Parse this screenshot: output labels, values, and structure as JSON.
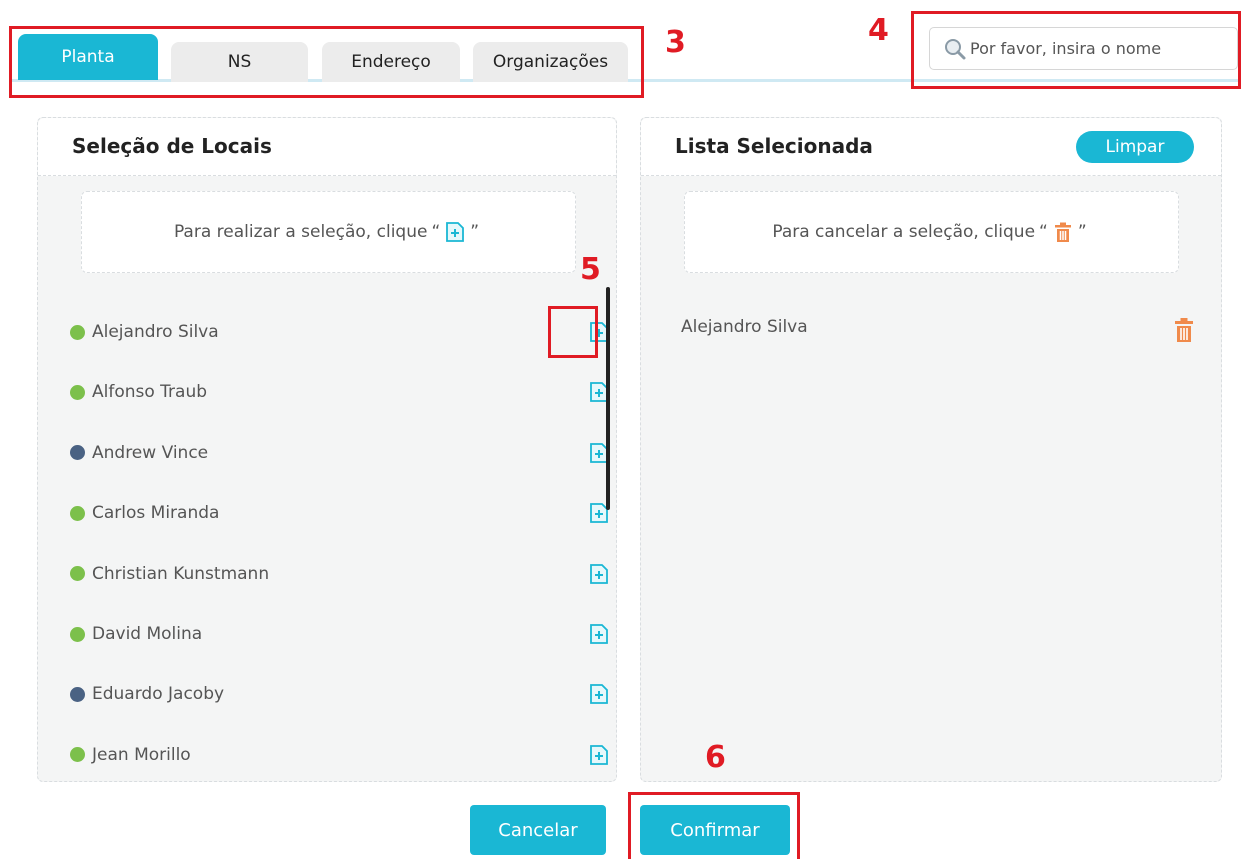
{
  "tabs": [
    {
      "label": "Planta",
      "active": true
    },
    {
      "label": "NS",
      "active": false
    },
    {
      "label": "Endereço",
      "active": false
    },
    {
      "label": "Organizações",
      "active": false
    }
  ],
  "search": {
    "placeholder": "Por favor, insira o nome",
    "value": ""
  },
  "left_panel": {
    "title": "Seleção de Locais",
    "hint_text": "Para realizar a seleção, clique",
    "items": [
      {
        "name": "Alejandro Silva",
        "status": "green"
      },
      {
        "name": "Alfonso Traub",
        "status": "green"
      },
      {
        "name": "Andrew Vince",
        "status": "navy"
      },
      {
        "name": "Carlos Miranda",
        "status": "green"
      },
      {
        "name": "Christian Kunstmann",
        "status": "green"
      },
      {
        "name": "David Molina",
        "status": "green"
      },
      {
        "name": "Eduardo Jacoby",
        "status": "navy"
      },
      {
        "name": "Jean Morillo",
        "status": "green"
      }
    ]
  },
  "right_panel": {
    "title": "Lista Selecionada",
    "clear_label": "Limpar",
    "hint_text": "Para cancelar a seleção, clique",
    "selected": [
      {
        "name": "Alejandro Silva"
      }
    ]
  },
  "buttons": {
    "cancel": "Cancelar",
    "confirm": "Confirmar"
  },
  "annotations": [
    "3",
    "4",
    "5",
    "6"
  ],
  "colors": {
    "accent": "#1ab7d4",
    "annotation": "#e01b24",
    "status_green": "#7cc04b",
    "status_navy": "#4a6283",
    "trash": "#f08a4b"
  },
  "icons": {
    "search": "search-icon",
    "add": "add-document-icon",
    "delete": "trash-icon"
  }
}
